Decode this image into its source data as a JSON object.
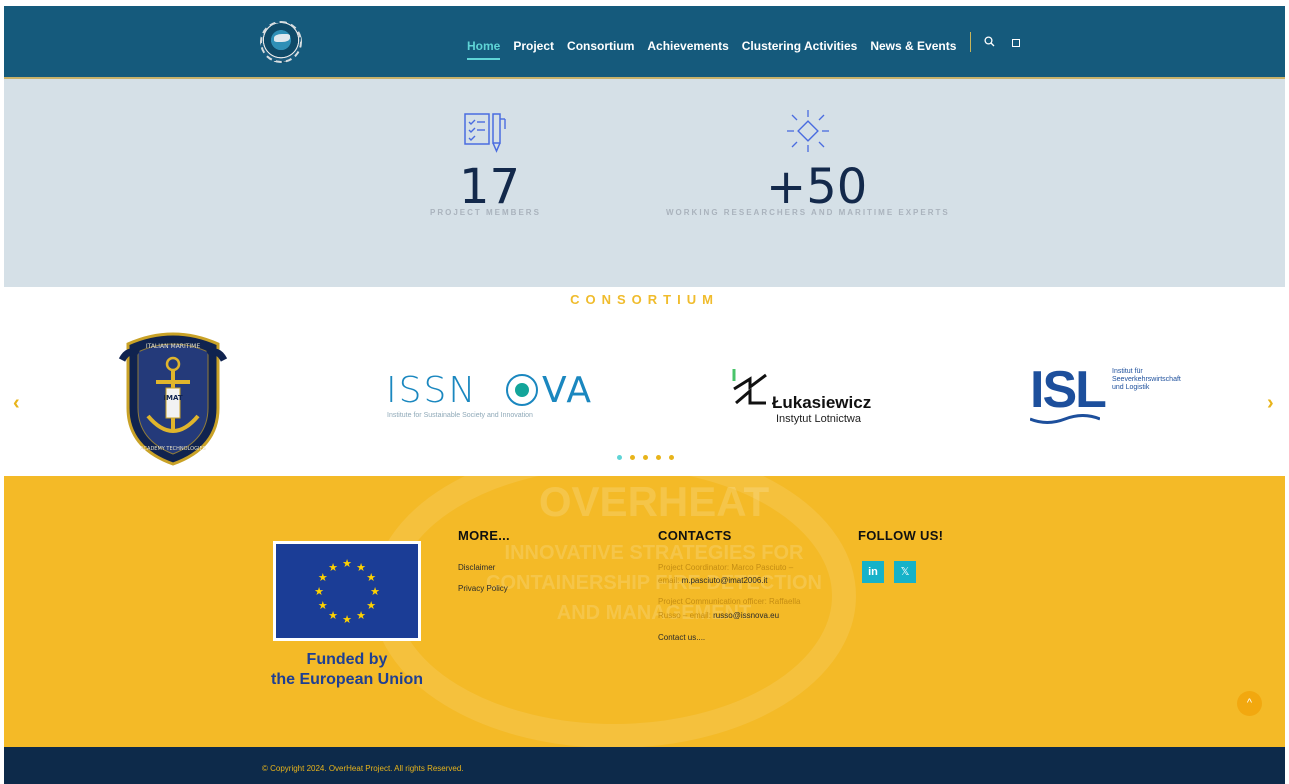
{
  "header": {
    "nav": [
      "Home",
      "Project",
      "Consortium",
      "Achievements",
      "Clustering Activities",
      "News & Events"
    ],
    "active_index": 0
  },
  "stats": [
    {
      "value": "17",
      "label": "PROJECT MEMBERS"
    },
    {
      "value": "+50",
      "label": "WORKING RESEARCHERS AND MARITIME EXPERTS"
    }
  ],
  "consortium": {
    "title": "CONSORTIUM",
    "logos": [
      {
        "name": "Italian Maritime Academy Technologies",
        "ring_text_top": "ITALIAN MARITIME",
        "ring_text_bottom": "ACADEMY TECHNOLOGIES",
        "mark": "IMAT"
      },
      {
        "name": "ISSNOVA",
        "wordmark_left": "ISSN",
        "wordmark_right": "VA",
        "tagline": "Institute for Sustainable Society and Innovation"
      },
      {
        "name": "Łukasiewicz",
        "wordmark": "Łukasiewicz",
        "sub": "Instytut Lotnictwa"
      },
      {
        "name": "ISL",
        "wordmark": "ISL",
        "lines": [
          "Institut für",
          "Seeverkehrswirtschaft",
          "und Logistik"
        ]
      }
    ],
    "prev": "‹",
    "next": "›",
    "dots": 5,
    "active_dot": 0
  },
  "footer": {
    "watermark": [
      "OVERHEAT",
      "INNOVATIVE STRATEGIES FOR",
      "CONTAINERSHIP FIRE DETECTION",
      "AND MANAGEMENT"
    ],
    "eu_text": [
      "Funded by",
      "the European Union"
    ],
    "more": {
      "title": "MORE...",
      "links": [
        "Disclaimer",
        "Privacy Policy"
      ]
    },
    "contacts": {
      "title": "CONTACTS",
      "coord_line1": "Project Coordinator: Marco Pasciuto –",
      "coord_label": "email: ",
      "coord_email": "m.pasciuto@imat2006.it",
      "comm_line1": "Project Communication officer: Raffaella",
      "comm_label": "Russo – email: ",
      "comm_email": "russo@issnova.eu",
      "contact_us": "Contact us...."
    },
    "follow": {
      "title": "FOLLOW US!",
      "linkedin": "in",
      "x": "𝕏"
    },
    "to_top": "^"
  },
  "copyright": "© Copyright 2024. OverHeat Project. All rights Reserved.",
  "colors": {
    "header": "#155a7c",
    "accent": "#5fd4d6",
    "gold": "#f4ba27",
    "navy": "#13294b",
    "footer_bottom": "#0d2a4a"
  }
}
